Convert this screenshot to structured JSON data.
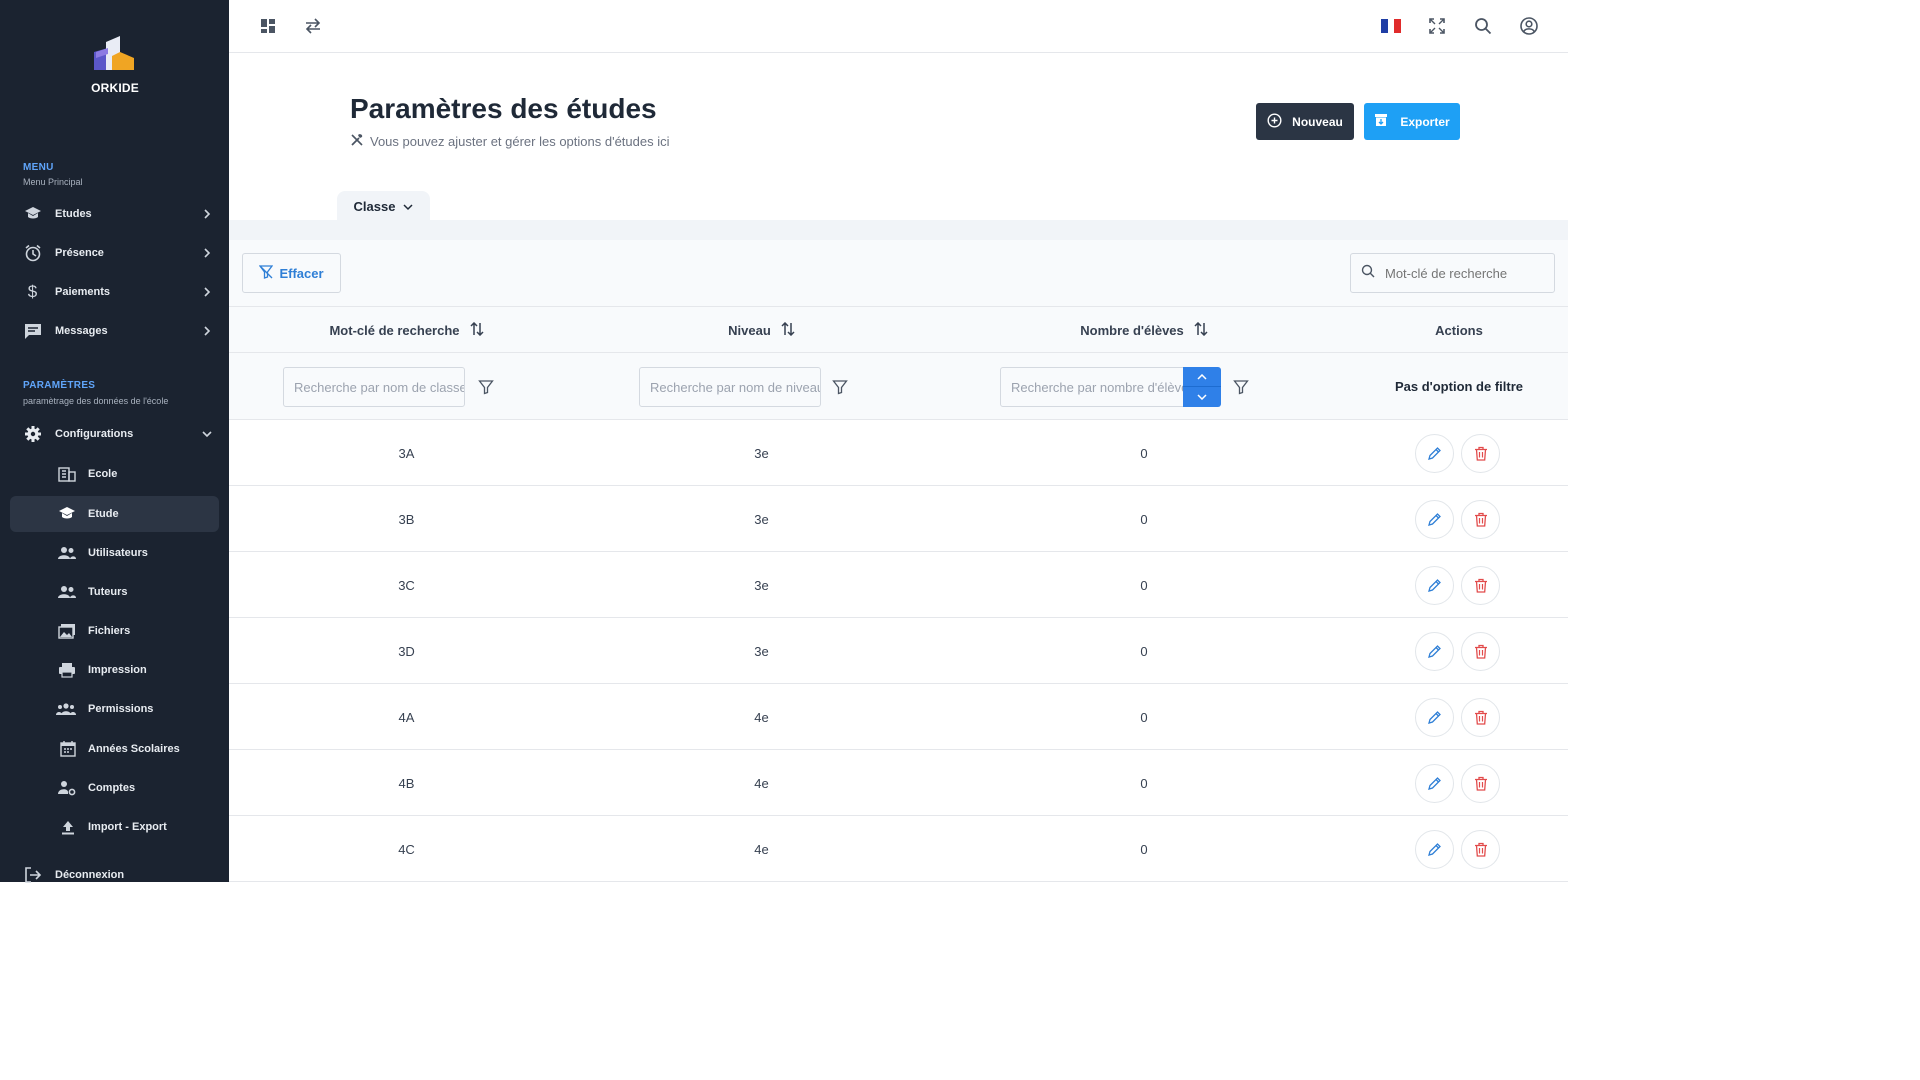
{
  "brand": {
    "name": "ORKIDE"
  },
  "sidebar": {
    "menu_title": "MENU",
    "menu_sub": "Menu Principal",
    "menu_items": [
      {
        "label": "Etudes",
        "icon": "graduation-cap-icon"
      },
      {
        "label": "Présence",
        "icon": "alarm-clock-icon"
      },
      {
        "label": "Paiements",
        "icon": "dollar-icon"
      },
      {
        "label": "Messages",
        "icon": "chat-icon"
      }
    ],
    "params_title": "PARAMÈTRES",
    "params_sub": "paramètrage des données de l'école",
    "config_label": "Configurations",
    "sub_items": [
      {
        "label": "Ecole",
        "icon": "building-icon"
      },
      {
        "label": "Etude",
        "icon": "graduation-cap-icon",
        "active": true
      },
      {
        "label": "Utilisateurs",
        "icon": "users-icon"
      },
      {
        "label": "Tuteurs",
        "icon": "users-icon"
      },
      {
        "label": "Fichiers",
        "icon": "images-icon"
      },
      {
        "label": "Impression",
        "icon": "printer-icon"
      },
      {
        "label": "Permissions",
        "icon": "group-icon"
      },
      {
        "label": "Années Scolaires",
        "icon": "calendar-icon"
      },
      {
        "label": "Comptes",
        "icon": "user-gear-icon"
      },
      {
        "label": "Import - Export",
        "icon": "upload-icon"
      }
    ],
    "logout_label": "Déconnexion"
  },
  "header": {
    "title": "Paramètres des études",
    "subtitle": "Vous pouvez ajuster et gérer les options d'études ici",
    "new_label": "Nouveau",
    "export_label": "Exporter"
  },
  "tab": {
    "label": "Classe"
  },
  "toolbar": {
    "clear_label": "Effacer",
    "search_placeholder": "Mot-clé de recherche"
  },
  "table": {
    "columns": [
      "Mot-clé de recherche",
      "Niveau",
      "Nombre d'élèves",
      "Actions"
    ],
    "filters": {
      "class_placeholder": "Recherche par nom de classe",
      "level_placeholder": "Recherche par nom de niveau",
      "count_placeholder": "Recherche par nombre d'élèves",
      "no_filter": "Pas d'option de filtre"
    },
    "rows": [
      {
        "name": "3A",
        "level": "3e",
        "count": "0"
      },
      {
        "name": "3B",
        "level": "3e",
        "count": "0"
      },
      {
        "name": "3C",
        "level": "3e",
        "count": "0"
      },
      {
        "name": "3D",
        "level": "3e",
        "count": "0"
      },
      {
        "name": "4A",
        "level": "4e",
        "count": "0"
      },
      {
        "name": "4B",
        "level": "4e",
        "count": "0"
      },
      {
        "name": "4C",
        "level": "4e",
        "count": "0"
      }
    ]
  },
  "colors": {
    "sidebar": "#1b2330",
    "accent": "#1ea0f5",
    "dark_button": "#2b3544",
    "delete": "#e24b4b",
    "edit": "#2f7fd6"
  }
}
